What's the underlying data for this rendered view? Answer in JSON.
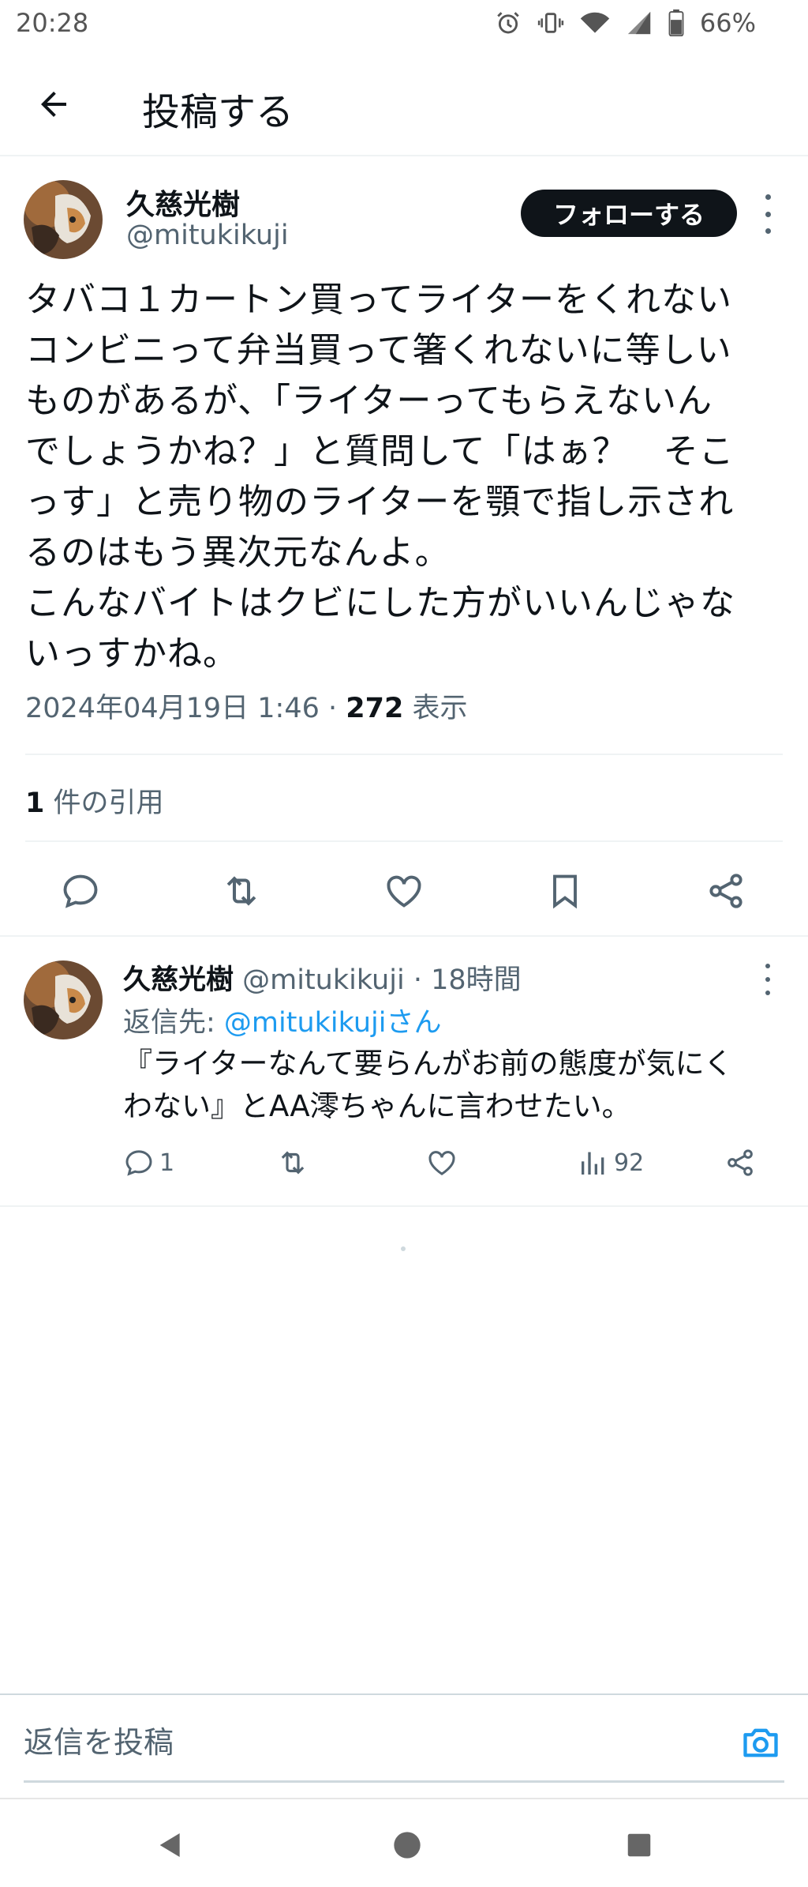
{
  "status_bar": {
    "time": "20:28",
    "battery": "66%"
  },
  "header": {
    "title": "投稿する"
  },
  "post": {
    "author_name": "久慈光樹",
    "author_handle": "@mitukikuji",
    "follow_label": "フォローする",
    "text": "タバコ１カートン買ってライターをくれない\nコンビニって弁当買って箸くれないに等しい\nものがあるが、「ライターってもらえないん\nでしょうかね？」と質問して「はぁ？　そこ\nっす」と売り物のライターを顎で指し示され\nるのはもう異次元なんよ。\nこんなバイトはクビにした方がいいんじゃな\nいっすかね。",
    "date": "2024年04月19日 1:46 · ",
    "views_count": "272",
    "views_label": " 表示",
    "quote_count": "1",
    "quote_label": " 件の引用",
    "actions": [
      "reply-icon",
      "retweet-icon",
      "like-icon",
      "bookmark-icon",
      "share-icon"
    ]
  },
  "reply": {
    "author_name": "久慈光樹",
    "author_handle": " @mitukikuji",
    "time_ago": " · 18時間",
    "reply_to_prefix": "返信先: ",
    "reply_to_mention": "@mitukikujiさん",
    "text": "『ライターなんて要らんがお前の態度が気にく\nわない』とAA澪ちゃんに言わせたい。",
    "reply_count": "1",
    "views_count": "92"
  },
  "composer": {
    "placeholder": "返信を投稿"
  },
  "colors": {
    "accent": "#1d9bf0",
    "text_primary": "#0f1419",
    "text_secondary": "#536471",
    "follow_bg": "#0f1419"
  }
}
